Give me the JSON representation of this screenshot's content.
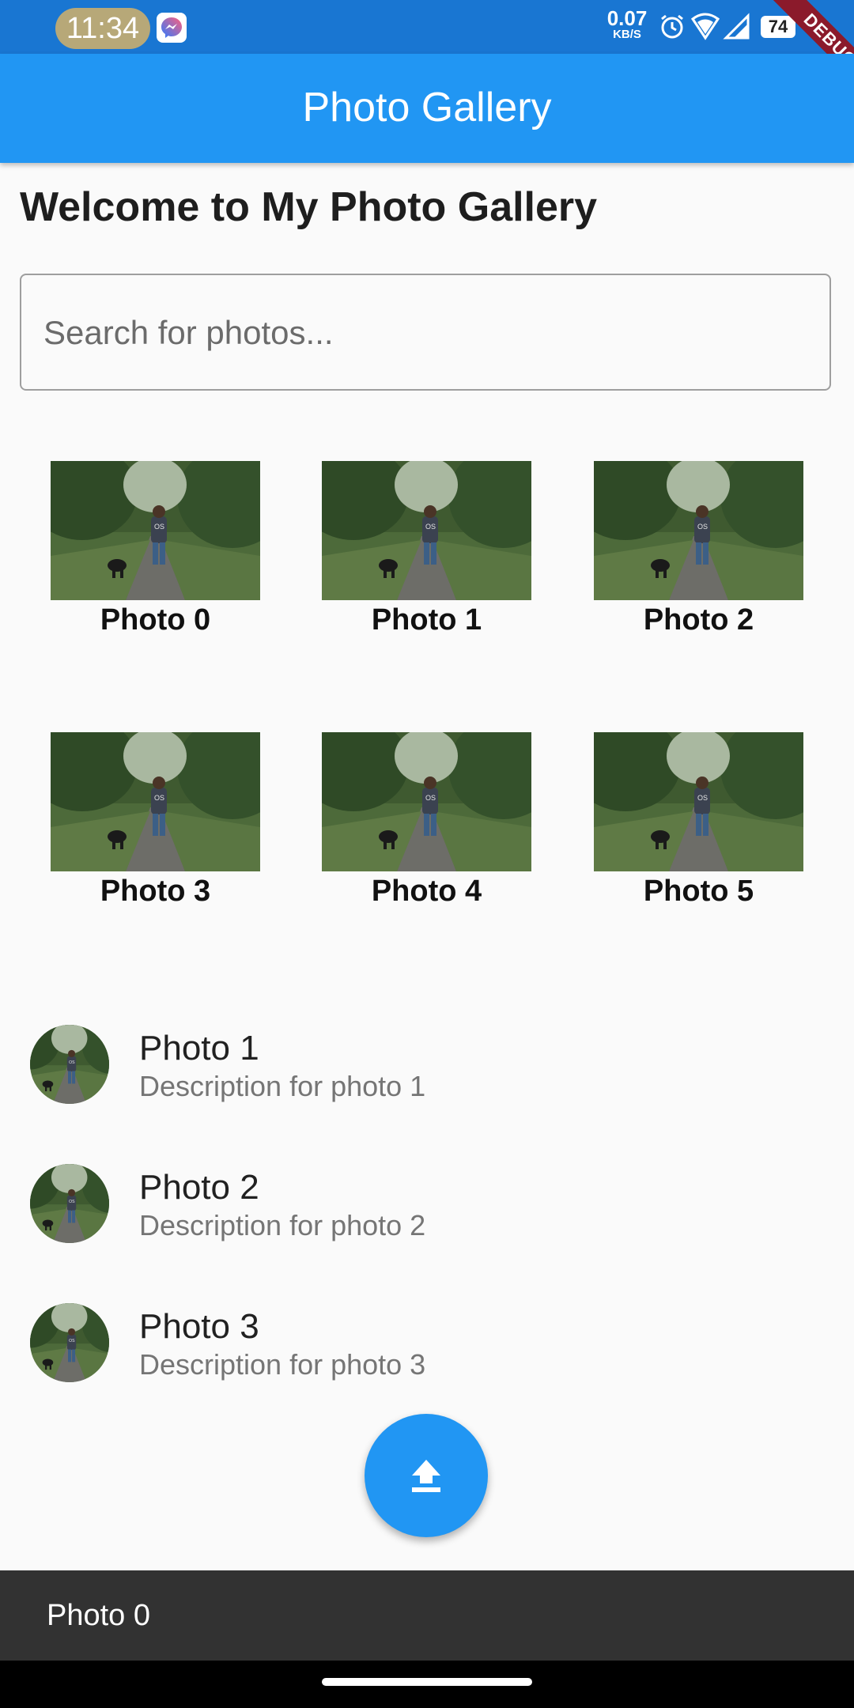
{
  "status_bar": {
    "time": "11:34",
    "net_speed": "0.07",
    "net_unit": "KB/S",
    "battery": "74",
    "debug_banner": "DEBUG",
    "icons": [
      "messenger-icon",
      "alarm-icon",
      "wifi-icon",
      "signal-icon",
      "battery-icon"
    ]
  },
  "app_bar": {
    "title": "Photo Gallery"
  },
  "welcome": "Welcome to My Photo Gallery",
  "search": {
    "placeholder": "Search for photos...",
    "value": ""
  },
  "grid": {
    "items": [
      {
        "label": "Photo 0"
      },
      {
        "label": "Photo 1"
      },
      {
        "label": "Photo 2"
      },
      {
        "label": "Photo 3"
      },
      {
        "label": "Photo 4"
      },
      {
        "label": "Photo 5"
      }
    ]
  },
  "list": {
    "items": [
      {
        "title": "Photo 1",
        "subtitle": "Description for photo 1"
      },
      {
        "title": "Photo 2",
        "subtitle": "Description for photo 2"
      },
      {
        "title": "Photo 3",
        "subtitle": "Description for photo 3"
      }
    ]
  },
  "fab": {
    "icon": "upload-icon"
  },
  "snackbar": {
    "text": "Photo 0"
  },
  "colors": {
    "primary": "#2196f3",
    "status_bar": "#1976d2",
    "snackbar": "#323232",
    "debug_banner": "#8b1a2b"
  }
}
